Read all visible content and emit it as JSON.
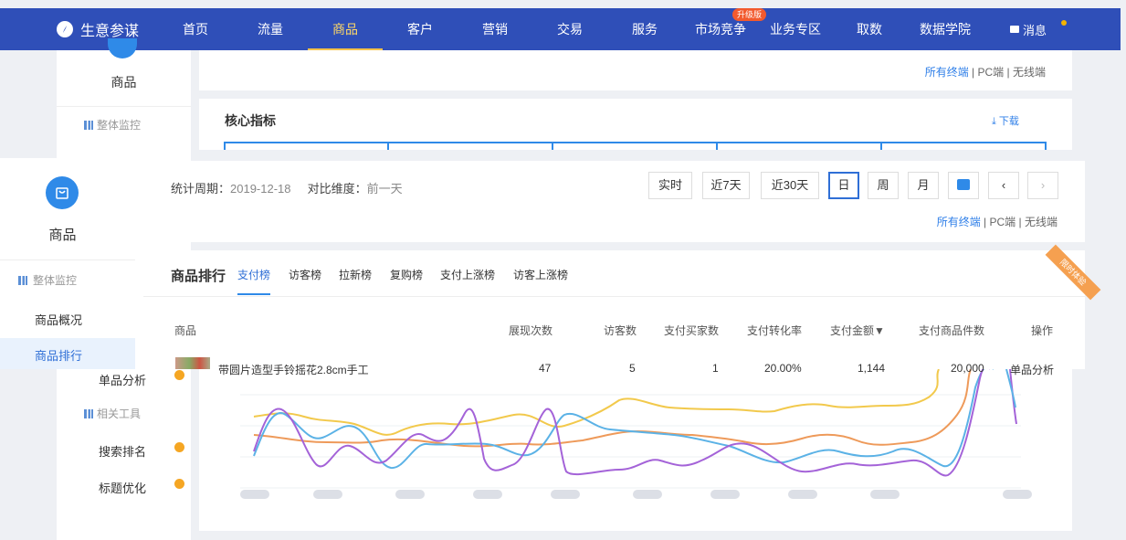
{
  "nav": {
    "brand": "生意参谋",
    "items": [
      "首页",
      "流量",
      "商品",
      "客户",
      "营销",
      "交易",
      "服务",
      "市场竞争",
      "业务专区",
      "取数",
      "数据学院"
    ],
    "active_index": 2,
    "badge": "升级版",
    "message": "消息"
  },
  "background": {
    "side_title": "商品",
    "side_sub": "整体监控",
    "terms": {
      "all": "所有终端",
      "pc": "PC端",
      "wireless": "无线端"
    },
    "card_title": "核心指标",
    "download": "下载",
    "lower_items": [
      "单品分析",
      "搜索排名",
      "标题优化"
    ],
    "lower_sub": "相关工具"
  },
  "overlay": {
    "side_title": "商品",
    "side_sub": "整体监控",
    "side_items": [
      "商品概况",
      "商品排行"
    ],
    "period_label": "统计周期：",
    "period_value": "2019-12-18",
    "compare_label": "对比维度：",
    "compare_value": "前一天",
    "buttons": [
      "实时",
      "近7天",
      "近30天",
      "日",
      "周",
      "月"
    ],
    "selected_button": "日",
    "terms": {
      "all": "所有终端",
      "pc": "PC端",
      "wireless": "无线端"
    },
    "rank_title": "商品排行",
    "rank_tabs": [
      "支付榜",
      "访客榜",
      "拉新榜",
      "复购榜",
      "支付上涨榜",
      "访客上涨榜"
    ],
    "ribbon": "限时体验",
    "columns": [
      "商品",
      "展现次数",
      "访客数",
      "支付买家数",
      "支付转化率",
      "支付金额▼",
      "支付商品件数",
      "操作"
    ],
    "row": [
      "带圆片造型手铃摇花2.8cm手工",
      "47",
      "5",
      "1",
      "20.00%",
      "1,144",
      "20,000",
      "单品分析"
    ]
  },
  "colors": {
    "nav": "#2f4fb8",
    "accent": "#2f8ae8",
    "yellow": "#f2c94c",
    "orange": "#ee9a5a",
    "blue": "#5bb2e6",
    "purple": "#a463d8"
  }
}
